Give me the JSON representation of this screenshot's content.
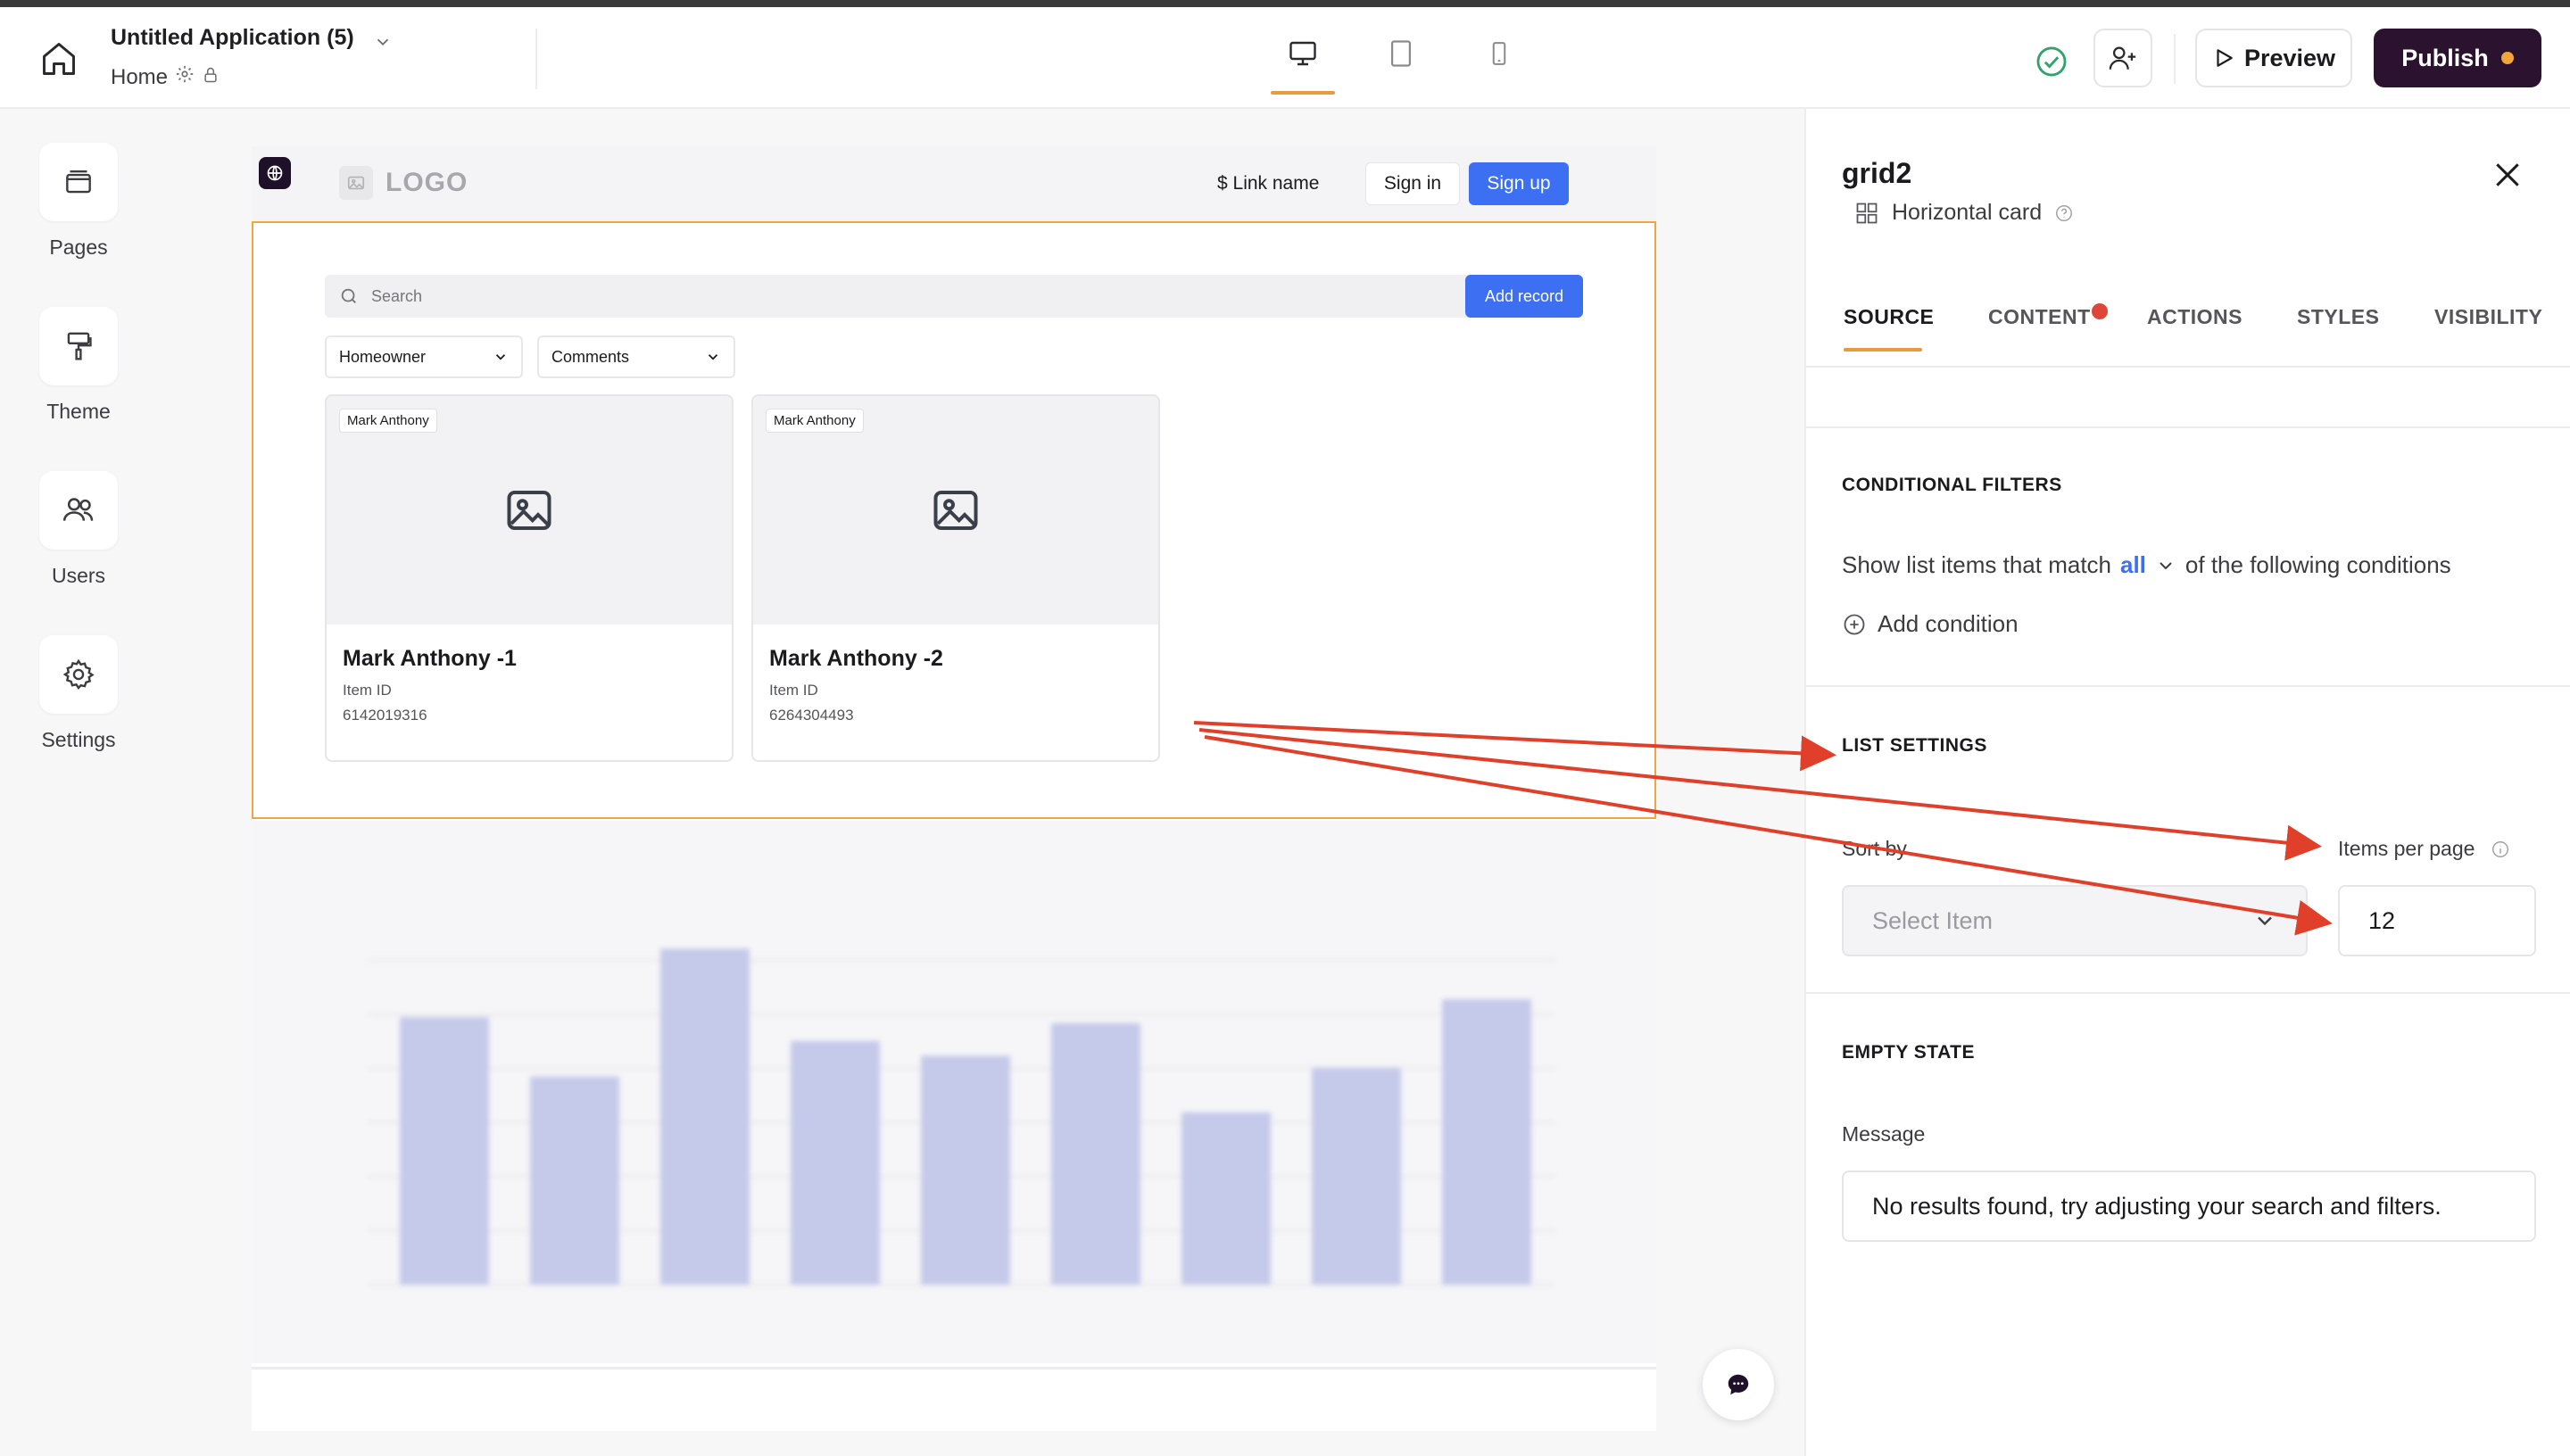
{
  "header": {
    "app_title": "Untitled Application (5)",
    "page_name": "Home",
    "preview_label": "Preview",
    "publish_label": "Publish",
    "publish_dot_color": "#f2a63a"
  },
  "rail": {
    "items": [
      {
        "label": "Pages",
        "icon": "pages-icon"
      },
      {
        "label": "Theme",
        "icon": "paint-roller-icon"
      },
      {
        "label": "Users",
        "icon": "users-icon"
      },
      {
        "label": "Settings",
        "icon": "gear-icon"
      }
    ]
  },
  "site": {
    "logo_text": "LOGO",
    "nav_link": "$ Link name",
    "signin_label": "Sign in",
    "signup_label": "Sign up"
  },
  "grid": {
    "search_placeholder": "Search",
    "add_record_label": "Add record",
    "filters": [
      "Homeowner",
      "Comments"
    ],
    "cards": [
      {
        "tag": "Mark Anthony",
        "title": "Mark Anthony -1",
        "id_label": "Item ID",
        "id_value": "6142019316"
      },
      {
        "tag": "Mark Anthony",
        "title": "Mark Anthony -2",
        "id_label": "Item ID",
        "id_value": "6264304493"
      }
    ]
  },
  "chart_data": {
    "type": "bar",
    "values": [
      90,
      70,
      113,
      82,
      77,
      88,
      58,
      73,
      96
    ],
    "color": "#c5c9ea"
  },
  "panel": {
    "title": "grid2",
    "subtitle": "Horizontal card",
    "tabs": [
      "SOURCE",
      "CONTENT",
      "ACTIONS",
      "STYLES",
      "VISIBILITY"
    ],
    "active_tab": "SOURCE",
    "content_badge_color": "#e0453a",
    "conditional_filters": {
      "heading": "CONDITIONAL FILTERS",
      "prefix": "Show list items that match",
      "match": "all",
      "suffix": "of the following conditions",
      "add_label": "Add condition"
    },
    "list_settings": {
      "heading": "LIST SETTINGS",
      "sort_label": "Sort by",
      "sort_placeholder": "Select Item",
      "ipp_label": "Items per page",
      "ipp_value": "12"
    },
    "empty_state": {
      "heading": "EMPTY STATE",
      "message_label": "Message",
      "message_value": "No results found, try adjusting your search and filters."
    }
  },
  "annotation_color": "#e0402a"
}
